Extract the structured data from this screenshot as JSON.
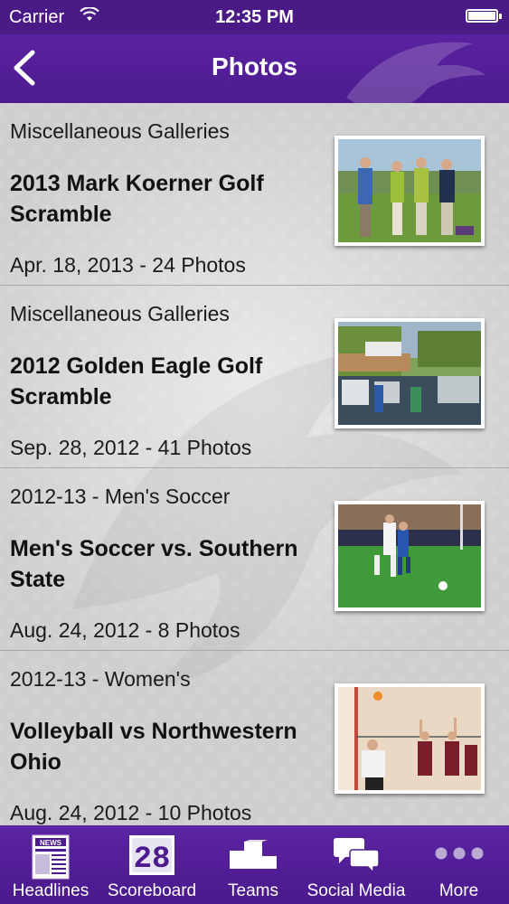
{
  "status_bar": {
    "carrier": "Carrier",
    "time": "12:35 PM"
  },
  "nav": {
    "title": "Photos"
  },
  "galleries": [
    {
      "category": "Miscellaneous Galleries",
      "title": "2013 Mark Koerner Golf Scramble",
      "meta": "Apr. 18, 2013 - 24 Photos"
    },
    {
      "category": "Miscellaneous Galleries",
      "title": "2012 Golden Eagle Golf Scramble",
      "meta": "Sep. 28, 2012 - 41 Photos"
    },
    {
      "category": "2012-13 - Men's Soccer",
      "title": "Men's Soccer vs. Southern State",
      "meta": "Aug. 24, 2012 - 8 Photos"
    },
    {
      "category": "2012-13 - Women's",
      "title": "Volleyball vs Northwestern Ohio",
      "meta": "Aug. 24, 2012 - 10 Photos"
    }
  ],
  "tabs": {
    "headlines": {
      "label": "Headlines",
      "icon_text": "NEWS"
    },
    "scoreboard": {
      "label": "Scoreboard",
      "icon_text": "28"
    },
    "teams": {
      "label": "Teams"
    },
    "social": {
      "label": "Social Media"
    },
    "more": {
      "label": "More"
    }
  },
  "colors": {
    "brand_purple": "#4d1b8f",
    "list_bg": "#d3d3d3"
  }
}
